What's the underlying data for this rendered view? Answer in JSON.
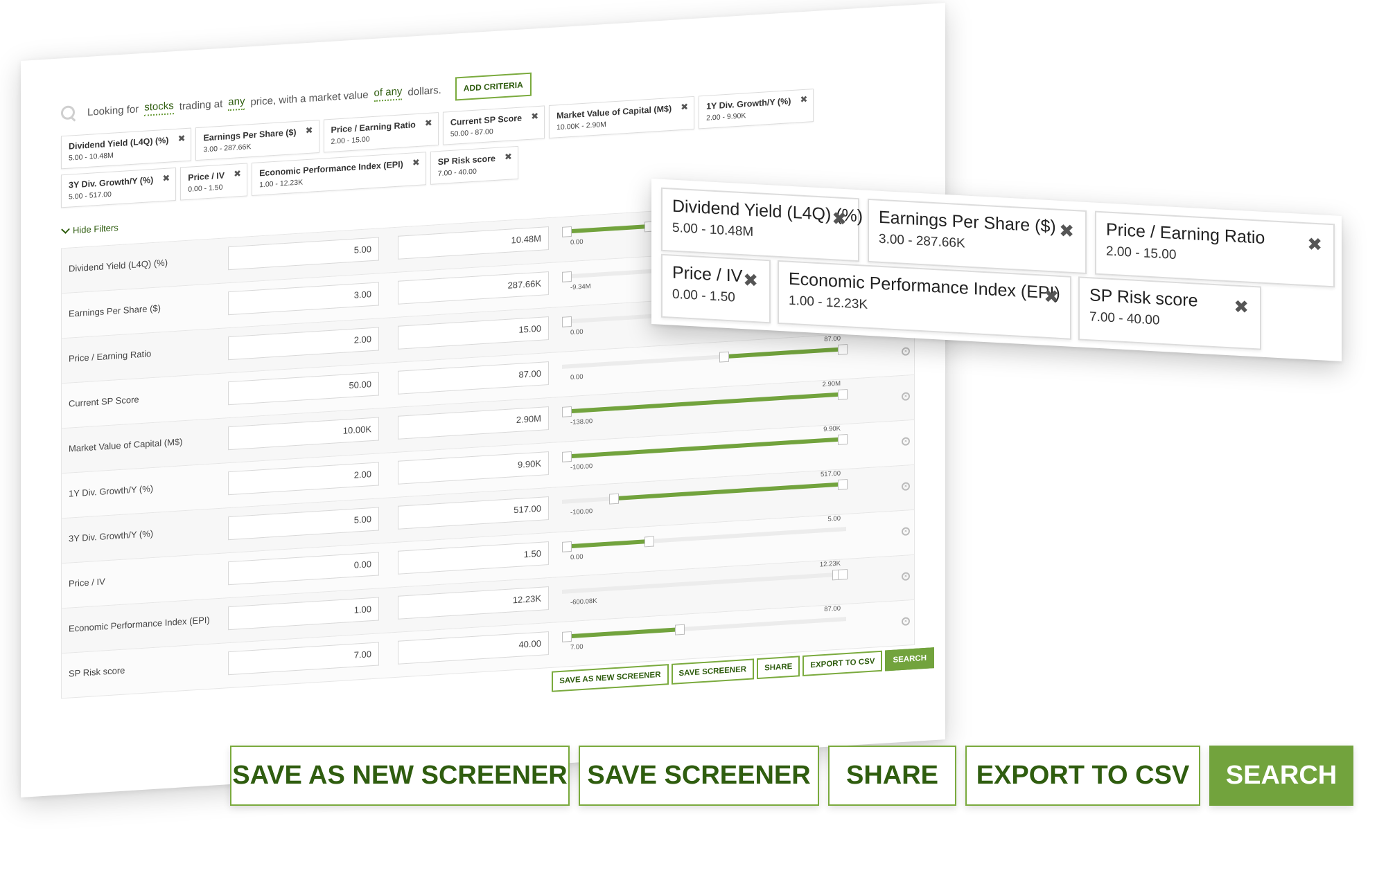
{
  "search": {
    "prefix": "Looking for",
    "asset": "stocks",
    "mid1": "trading at",
    "price": "any",
    "mid2": "price, with a market value",
    "value": "of any",
    "suffix": "dollars.",
    "add_criteria": "ADD CRITERIA"
  },
  "tags": [
    {
      "name": "Dividend Yield (L4Q) (%)",
      "range": "5.00 - 10.48M"
    },
    {
      "name": "Earnings Per Share ($)",
      "range": "3.00 - 287.66K"
    },
    {
      "name": "Price / Earning Ratio",
      "range": "2.00 - 15.00"
    },
    {
      "name": "Current SP Score",
      "range": "50.00 - 87.00"
    },
    {
      "name": "Market Value of Capital (M$)",
      "range": "10.00K - 2.90M"
    },
    {
      "name": "1Y Div. Growth/Y (%)",
      "range": "2.00 - 9.90K"
    },
    {
      "name": "3Y Div. Growth/Y (%)",
      "range": "5.00 - 517.00"
    },
    {
      "name": "Price / IV",
      "range": "0.00 - 1.50"
    },
    {
      "name": "Economic Performance Index (EPI)",
      "range": "1.00 - 12.23K"
    },
    {
      "name": "SP Risk score",
      "range": "7.00 - 40.00"
    }
  ],
  "hide_filters": "Hide Filters",
  "filters": [
    {
      "label": "Dividend Yield (L4Q) (%)",
      "min": "5.00",
      "max": "10.48M",
      "slider_min": "0.00",
      "slider_max": "",
      "lo": 0.0,
      "hi": 0.3
    },
    {
      "label": "Earnings Per Share ($)",
      "min": "3.00",
      "max": "287.66K",
      "slider_min": "-9.34M",
      "slider_max": "",
      "lo": 0.0,
      "hi": 0.0
    },
    {
      "label": "Price / Earning Ratio",
      "min": "2.00",
      "max": "15.00",
      "slider_min": "0.00",
      "slider_max": "",
      "lo": 0.0,
      "hi": 0.0
    },
    {
      "label": "Current SP Score",
      "min": "50.00",
      "max": "87.00",
      "slider_min": "0.00",
      "slider_max": "87.00",
      "lo": 0.57,
      "hi": 1.0
    },
    {
      "label": "Market Value of Capital (M$)",
      "min": "10.00K",
      "max": "2.90M",
      "slider_min": "-138.00",
      "slider_max": "2.90M",
      "lo": 0.0,
      "hi": 1.0
    },
    {
      "label": "1Y Div. Growth/Y (%)",
      "min": "2.00",
      "max": "9.90K",
      "slider_min": "-100.00",
      "slider_max": "9.90K",
      "lo": 0.0,
      "hi": 1.0
    },
    {
      "label": "3Y Div. Growth/Y (%)",
      "min": "5.00",
      "max": "517.00",
      "slider_min": "-100.00",
      "slider_max": "517.00",
      "lo": 0.17,
      "hi": 1.0
    },
    {
      "label": "Price / IV",
      "min": "0.00",
      "max": "1.50",
      "slider_min": "0.00",
      "slider_max": "5.00",
      "lo": 0.0,
      "hi": 0.3
    },
    {
      "label": "Economic Performance Index (EPI)",
      "min": "1.00",
      "max": "12.23K",
      "slider_min": "-600.08K",
      "slider_max": "12.23K",
      "lo": 0.98,
      "hi": 1.0
    },
    {
      "label": "SP Risk score",
      "min": "7.00",
      "max": "40.00",
      "slider_min": "7.00",
      "slider_max": "87.00",
      "lo": 0.0,
      "hi": 0.41
    }
  ],
  "buttons": {
    "save_as_new": "SAVE AS NEW SCREENER",
    "save": "SAVE SCREENER",
    "share": "SHARE",
    "export": "EXPORT TO CSV",
    "search": "SEARCH"
  },
  "callout_tags": [
    {
      "name": "Dividend Yield (L4Q) (%)",
      "range": "5.00 - 10.48M"
    },
    {
      "name": "Earnings Per Share ($)",
      "range": "3.00 - 287.66K"
    },
    {
      "name": "Price / Earning Ratio",
      "range": "2.00 - 15.00"
    },
    {
      "name": "Price / IV",
      "range": "0.00 - 1.50"
    },
    {
      "name": "Economic Performance Index (EPI)",
      "range": "1.00 - 12.23K"
    },
    {
      "name": "SP Risk score",
      "range": "7.00 - 40.00"
    }
  ],
  "colors": {
    "accent": "#72a33d",
    "accent_dark": "#2f5d0f"
  }
}
